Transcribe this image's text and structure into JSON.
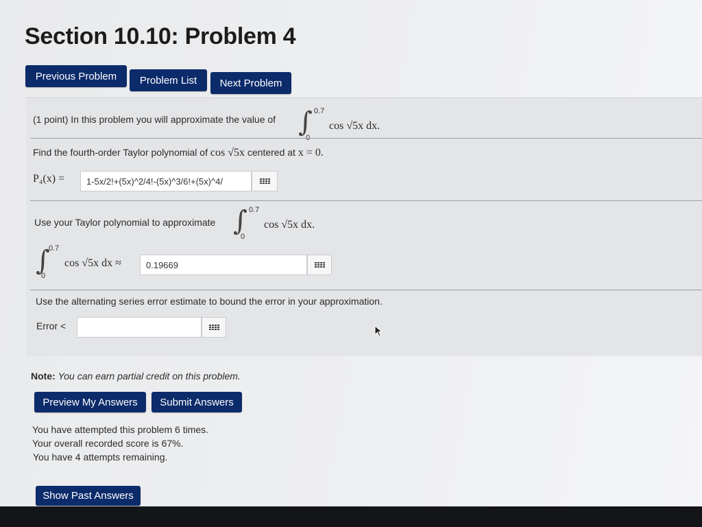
{
  "page": {
    "title": "Section 10.10: Problem 4"
  },
  "nav": {
    "previous": "Previous Problem",
    "list": "Problem List",
    "next": "Next Problem"
  },
  "problem": {
    "intro": "(1 point) In this problem you will approximate the value of",
    "integral": {
      "lower": "0",
      "upper": "0.7",
      "integrand": "cos √5x dx."
    },
    "part1": {
      "prompt_a": "Find the fourth-order Taylor polynomial of",
      "prompt_func": "cos √5x",
      "prompt_b": "centered at",
      "prompt_center": "x = 0.",
      "label": "P₄(x) =",
      "answer": "1-5x/2!+(5x)^2/4!-(5x)^3/6!+(5x)^4/"
    },
    "part2": {
      "prompt": "Use your Taylor polynomial to approximate",
      "integrand": "cos √5x dx.",
      "lhs_integrand": "cos √5x dx ≈",
      "answer": "0.19669"
    },
    "part3": {
      "prompt": "Use the alternating series error estimate to bound the error in your approximation.",
      "label": "Error <",
      "answer": ""
    }
  },
  "note": {
    "bold": "Note:",
    "text": "You can earn partial credit on this problem."
  },
  "actions": {
    "preview": "Preview My Answers",
    "submit": "Submit Answers",
    "past": "Show Past Answers"
  },
  "status": {
    "attempts": "You have attempted this problem 6 times.",
    "score": "Your overall recorded score is 67%.",
    "remaining": "You have 4 attempts remaining."
  },
  "icons": {
    "keyboard": "equation-editor-icon",
    "cursor": "mouse-pointer-icon"
  },
  "colors": {
    "button": "#0c2b6b",
    "panel": "#e4e5e7"
  }
}
